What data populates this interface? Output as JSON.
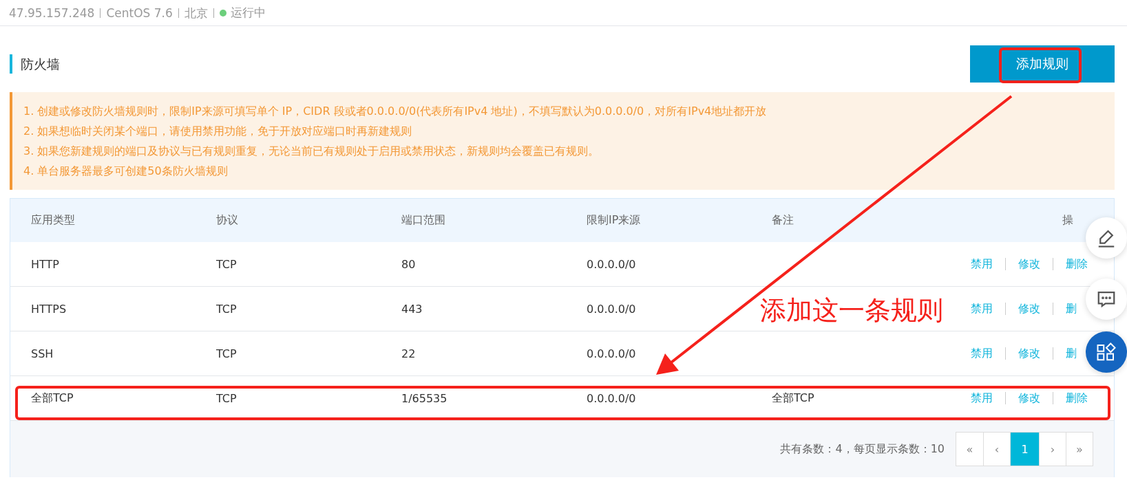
{
  "server_bar": {
    "items": [
      "47.95.157.248",
      "CentOS  7.6",
      "北京"
    ],
    "status": {
      "label": "运行中",
      "running": true
    }
  },
  "section": {
    "title": "防火墙",
    "add_button": {
      "label": "添加规则",
      "highlighted": true
    }
  },
  "notice": [
    "1. 创建或修改防火墙规则时，限制IP来源可填写单个 IP，CIDR 段或者0.0.0.0/0(代表所有IPv4 地址)，不填写默认为0.0.0.0/0，对所有IPv4地址都开放",
    "2. 如果想临时关闭某个端口，请使用禁用功能，免于开放对应端口时再新建规则",
    "3. 如果您新建规则的端口及协议与已有规则重复，无论当前已有规则处于启用或禁用状态，新规则均会覆盖已有规则。",
    "4. 单台服务器最多可创建50条防火墙规则"
  ],
  "table": {
    "columns": [
      "应用类型",
      "协议",
      "端口范围",
      "限制IP来源",
      "备注",
      "操"
    ],
    "rows": [
      {
        "cells": [
          "HTTP",
          "TCP",
          "80",
          "0.0.0.0/0",
          ""
        ],
        "actions": [
          "禁用",
          "修改",
          "删除"
        ],
        "highlighted": false
      },
      {
        "cells": [
          "HTTPS",
          "TCP",
          "443",
          "0.0.0.0/0",
          ""
        ],
        "actions": [
          "禁用",
          "修改",
          "删"
        ],
        "highlighted": false
      },
      {
        "cells": [
          "SSH",
          "TCP",
          "22",
          "0.0.0.0/0",
          ""
        ],
        "actions": [
          "禁用",
          "修改",
          "删"
        ],
        "highlighted": false
      },
      {
        "cells": [
          "全部TCP",
          "TCP",
          "1/65535",
          "0.0.0.0/0",
          "全部TCP"
        ],
        "actions": [
          "禁用",
          "修改",
          "删除"
        ],
        "highlighted": true
      }
    ]
  },
  "pagination": {
    "summary": "共有条数：4，每页显示条数：10",
    "pages": [
      {
        "label": "«",
        "selected": false
      },
      {
        "label": "‹",
        "selected": false
      },
      {
        "label": "1",
        "selected": true
      },
      {
        "label": "›",
        "selected": false
      },
      {
        "label": "»",
        "selected": false
      }
    ]
  },
  "annotation": {
    "callout": "添加这一条规则"
  }
}
